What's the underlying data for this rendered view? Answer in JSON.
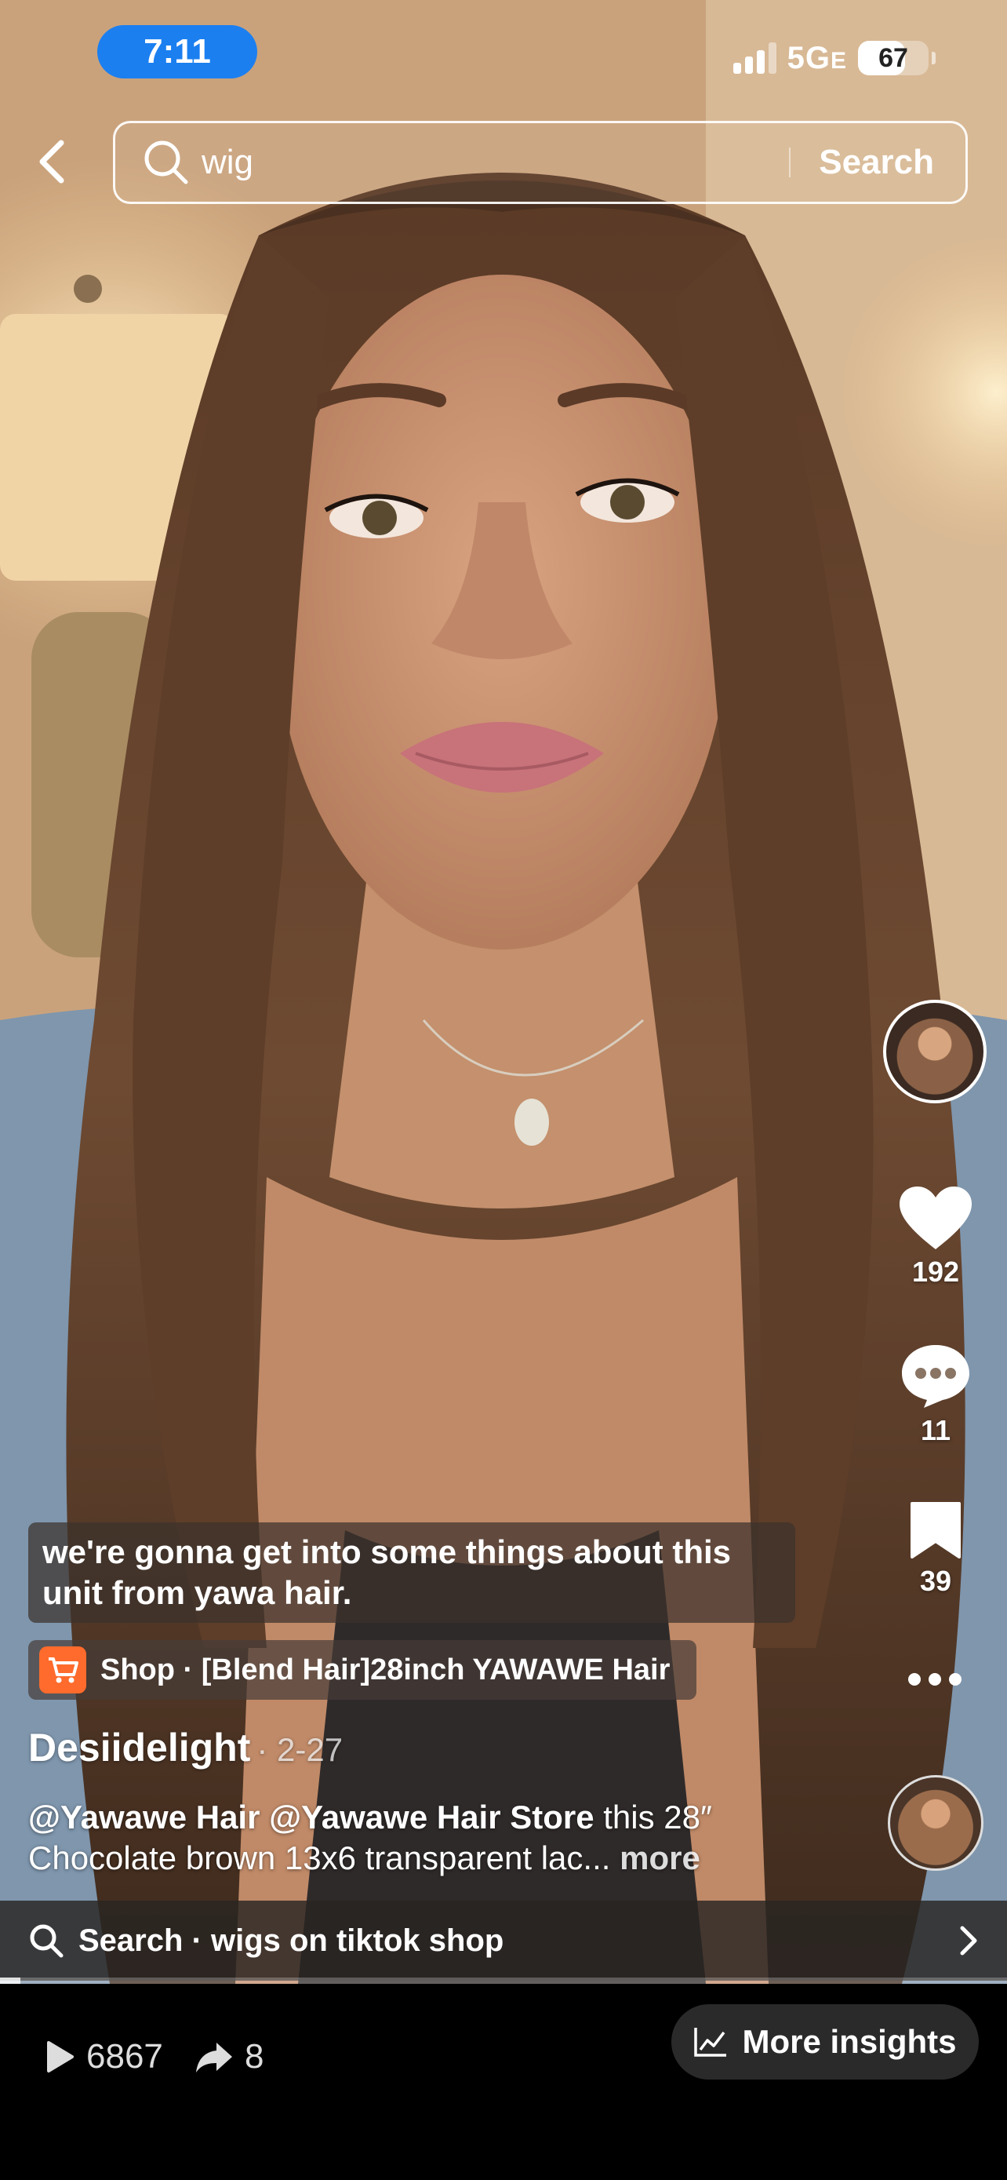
{
  "status_bar": {
    "time": "7:11",
    "network": "5G",
    "network_suffix": "E",
    "battery_level": "67",
    "battery_fraction": 0.67
  },
  "search": {
    "query": "wig",
    "button_label": "Search"
  },
  "actions": {
    "likes": "192",
    "comments": "11",
    "saves": "39"
  },
  "caption": "we're gonna get into some things about this unit from yawa hair.",
  "shop": {
    "label": "Shop · [Blend Hair]28inch YAWAWE Hair"
  },
  "post": {
    "author": "Desiidelight",
    "date": "· 2-27",
    "mention_1": "@Yawawe Hair",
    "mention_2": "@Yawawe Hair Store",
    "text": "this 28″ Chocolate brown 13x6 transparent lac...",
    "more_label": "more"
  },
  "bottom_search": {
    "label": "Search · wigs on tiktok shop"
  },
  "playback_progress": 0.02,
  "stats": {
    "plays": "6867",
    "shares": "8",
    "insights_label": "More insights"
  },
  "colors": {
    "status_pill": "#1b7ff0",
    "shop_icon": "#fe6b2c"
  },
  "icons": [
    "back-chevron-icon",
    "search-icon",
    "heart-icon",
    "comment-icon",
    "bookmark-icon",
    "more-dots-icon",
    "shopping-cart-icon",
    "chevron-right-icon",
    "play-icon",
    "share-icon",
    "chart-icon"
  ]
}
